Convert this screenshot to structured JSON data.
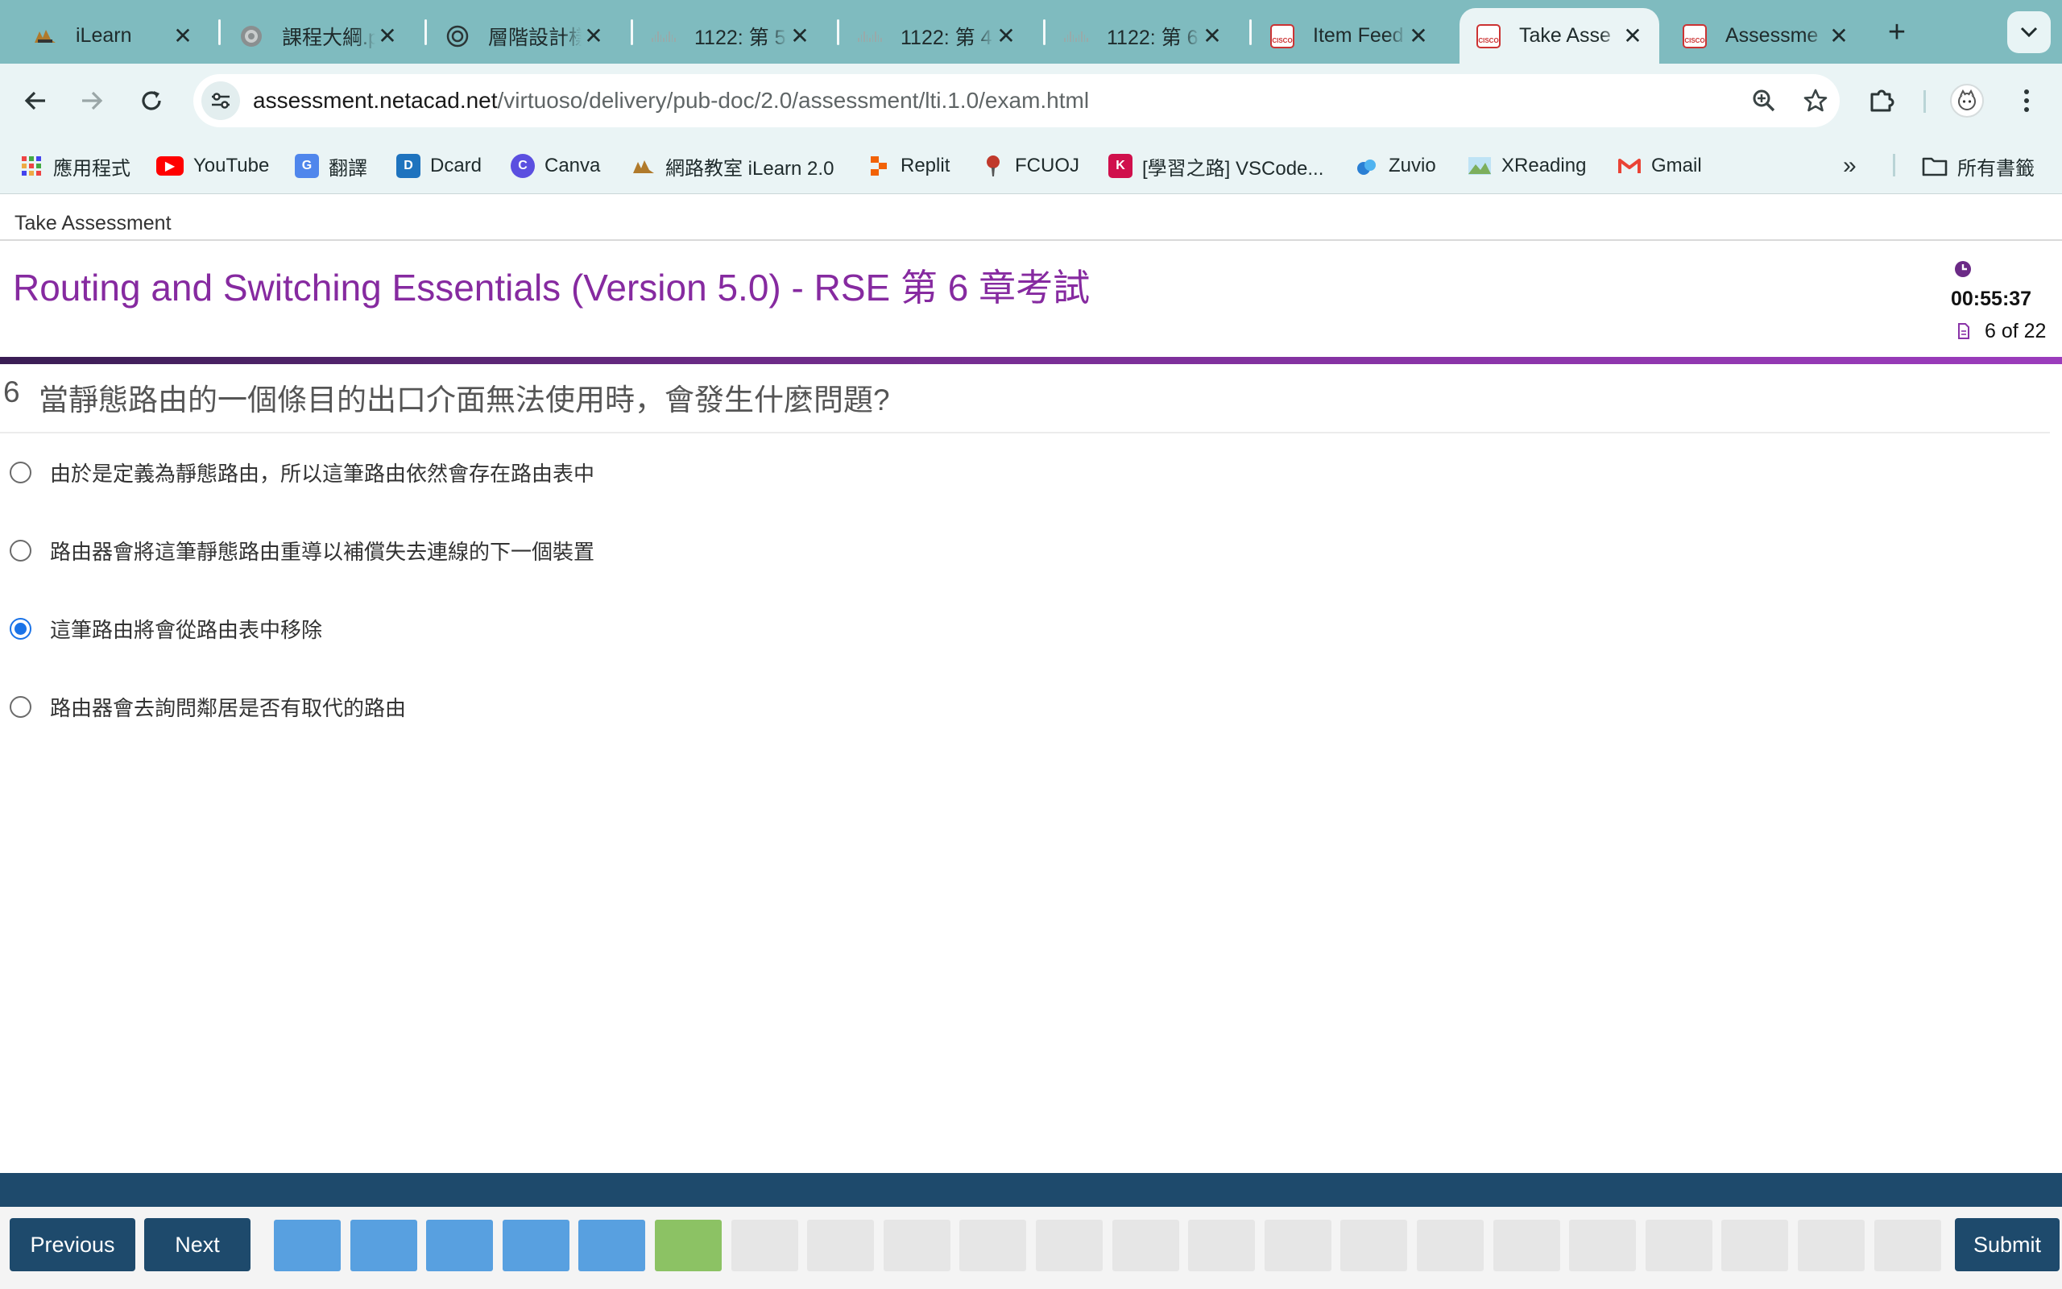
{
  "browser": {
    "tabs": [
      {
        "title": "iLearn",
        "icon": "ilearn-icon",
        "active": false
      },
      {
        "title": "課程大綱.p",
        "icon": "seal-icon",
        "active": false
      },
      {
        "title": "層階設計樣",
        "icon": "openai-icon",
        "active": false
      },
      {
        "title": "1122: 第 5",
        "icon": "cisco-icon",
        "active": false
      },
      {
        "title": "1122: 第 4",
        "icon": "cisco-icon",
        "active": false
      },
      {
        "title": "1122: 第 6",
        "icon": "cisco-icon",
        "active": false
      },
      {
        "title": "Item Feed",
        "icon": "cisco-icon",
        "active": false
      },
      {
        "title": "Take Asse",
        "icon": "cisco-icon",
        "active": true
      },
      {
        "title": "Assessme",
        "icon": "cisco-icon",
        "active": false
      }
    ],
    "url_host": "assessment.netacad.net",
    "url_path": "/virtuoso/delivery/pub-doc/2.0/assessment/lti.1.0/exam.html",
    "bookmarks": [
      {
        "label": "應用程式",
        "icon": "apps-grid-icon"
      },
      {
        "label": "YouTube",
        "icon": "youtube-icon"
      },
      {
        "label": "翻譯",
        "icon": "translate-icon"
      },
      {
        "label": "Dcard",
        "icon": "dcard-icon"
      },
      {
        "label": "Canva",
        "icon": "canva-icon"
      },
      {
        "label": "網路教室 iLearn 2.0",
        "icon": "ilearn-icon"
      },
      {
        "label": "Replit",
        "icon": "replit-icon"
      },
      {
        "label": "FCUOJ",
        "icon": "fcuoj-icon"
      },
      {
        "label": "[學習之路] VSCode...",
        "icon": "bookmark-k-icon"
      },
      {
        "label": "Zuvio",
        "icon": "zuvio-icon"
      },
      {
        "label": "XReading",
        "icon": "xreading-icon"
      },
      {
        "label": "Gmail",
        "icon": "gmail-icon"
      }
    ],
    "all_bookmarks_label": "所有書籤"
  },
  "page": {
    "app_bar_title": "Take Assessment",
    "exam_title": "Routing and Switching Essentials (Version 5.0) - RSE 第 6 章考試",
    "timer": "00:55:37",
    "progress": "6 of 22",
    "question_number": "6",
    "question_text": "當靜態路由的一個條目的出口介面無法使用時，會發生什麼問題?",
    "options": [
      {
        "text": "由於是定義為靜態路由，所以這筆路由依然會存在路由表中",
        "selected": false
      },
      {
        "text": "路由器會將這筆靜態路由重導以補償失去連線的下一個裝置",
        "selected": false
      },
      {
        "text": "這筆路由將會從路由表中移除",
        "selected": true
      },
      {
        "text": "路由器會去詢問鄰居是否有取代的路由",
        "selected": false
      }
    ]
  },
  "footer": {
    "previous_label": "Previous",
    "next_label": "Next",
    "submit_label": "Submit",
    "question_status": [
      "answered",
      "answered",
      "answered",
      "answered",
      "answered",
      "current",
      "unanswered",
      "unanswered",
      "unanswered",
      "unanswered",
      "unanswered",
      "unanswered",
      "unanswered",
      "unanswered",
      "unanswered",
      "unanswered",
      "unanswered",
      "unanswered",
      "unanswered",
      "unanswered",
      "unanswered",
      "unanswered"
    ]
  },
  "colors": {
    "tabstrip": "#7fbbbf",
    "toolbar": "#eaf4f5",
    "title_purple": "#862aa0",
    "footer_navy": "#1e4a6c",
    "tile_answered": "#58a0e0",
    "tile_current": "#8cc264",
    "tile_unanswered": "#e6e6e6",
    "radio_selected": "#1a73e8"
  }
}
